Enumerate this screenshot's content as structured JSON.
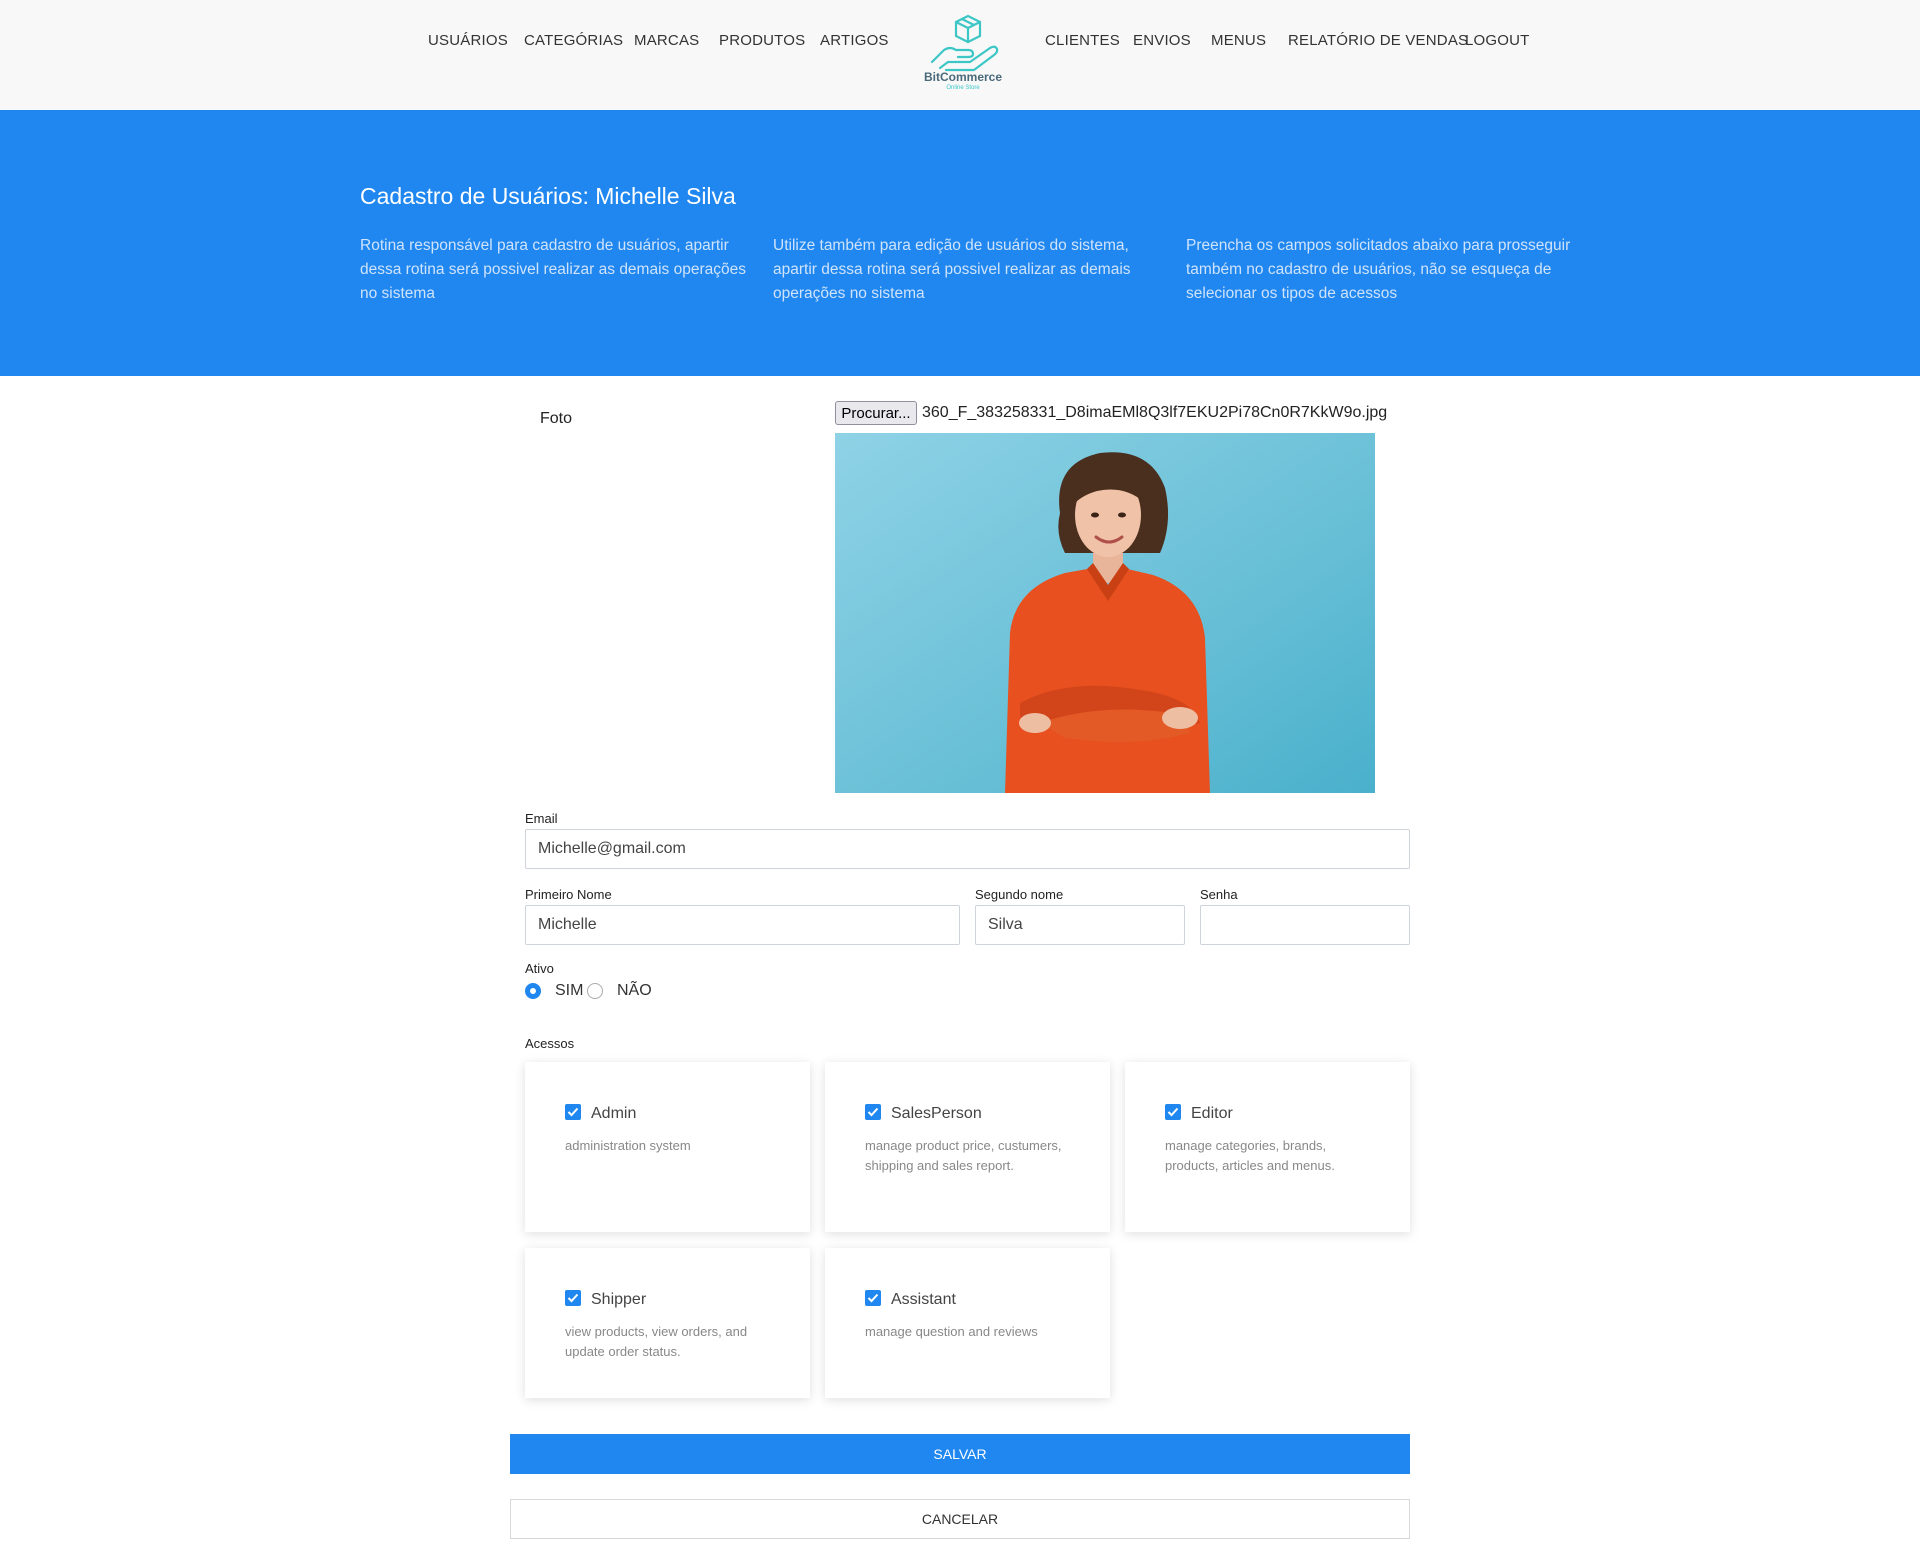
{
  "nav": {
    "left_items": [
      "USUÁRIOS",
      "CATEGÓRIAS",
      "MARCAS",
      "PRODUTOS",
      "ARTIGOS"
    ],
    "right_items": [
      "CLIENTES",
      "ENVIOS",
      "MENUS",
      "RELATÓRIO DE VENDAS",
      "LOGOUT"
    ],
    "logo_name": "BitCommerce",
    "logo_tagline": "Online Store",
    "logo_icon": "hand-holding-box-icon"
  },
  "hero": {
    "title": "Cadastro de Usuários: Michelle Silva",
    "columns": [
      "Rotina responsável para cadastro de usuários, apartir dessa rotina será possivel realizar as demais operações no sistema",
      "Utilize também para edição de usuários do sistema, apartir dessa rotina será possivel realizar as demais operações no sistema",
      "Preencha os campos solicitados abaixo para prosseguir também no cadastro de usuários, não se esqueça de selecionar os tipos de acessos"
    ]
  },
  "form": {
    "photo_label": "Foto",
    "browse_label": "Procurar...",
    "file_name": "360_F_383258331_D8imaEMl8Q3lf7EKU2Pi78Cn0R7KkW9o.jpg",
    "email_label": "Email",
    "email_value": "Michelle@gmail.com",
    "first_name_label": "Primeiro Nome",
    "first_name_value": "Michelle",
    "last_name_label": "Segundo nome",
    "last_name_value": "Silva",
    "password_label": "Senha",
    "password_value": "",
    "active_label": "Ativo",
    "active_yes": "SIM",
    "active_no": "NÃO",
    "active_selected": "SIM",
    "access_label": "Acessos",
    "roles": [
      {
        "name": "Admin",
        "description": "administration system",
        "checked": true
      },
      {
        "name": "SalesPerson",
        "description": "manage product price, custumers, shipping and sales report.",
        "checked": true
      },
      {
        "name": "Editor",
        "description": "manage categories, brands, products, articles and menus.",
        "checked": true
      },
      {
        "name": "Shipper",
        "description": "view products, view orders, and update order status.",
        "checked": true
      },
      {
        "name": "Assistant",
        "description": "manage question and reviews",
        "checked": true
      }
    ],
    "save_label": "SALVAR",
    "cancel_label": "CANCELAR"
  },
  "colors": {
    "primary": "#1f87ef",
    "navbar_bg": "#f8f8f8",
    "hero_text": "#cfe3fb",
    "logo_teal": "#3dc6c6"
  }
}
